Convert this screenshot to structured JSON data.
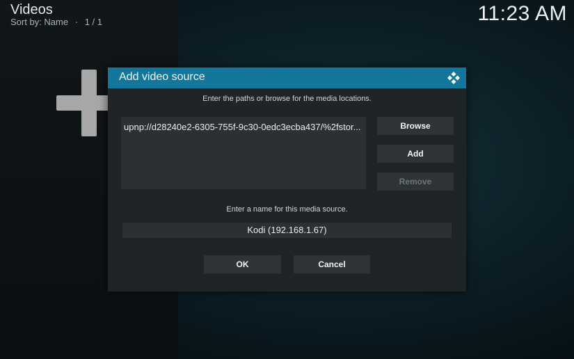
{
  "header": {
    "title": "Videos",
    "sort_label": "Sort by: Name",
    "separator": "·",
    "page_count": "1 / 1"
  },
  "clock": "11:23 AM",
  "dialog": {
    "title": "Add video source",
    "paths_instruction": "Enter the paths or browse for the media locations.",
    "paths": [
      "upnp://d28240e2-6305-755f-9c30-0edc3ecba437/%2fstor..."
    ],
    "buttons": {
      "browse": "Browse",
      "add": "Add",
      "remove": "Remove",
      "ok": "OK",
      "cancel": "Cancel"
    },
    "name_instruction": "Enter a name for this media source.",
    "name_value": "Kodi (192.168.1.67)"
  },
  "colors": {
    "header_bar": "#12779a",
    "dialog_bg": "#1f2426",
    "button_bg": "#2e3436"
  }
}
